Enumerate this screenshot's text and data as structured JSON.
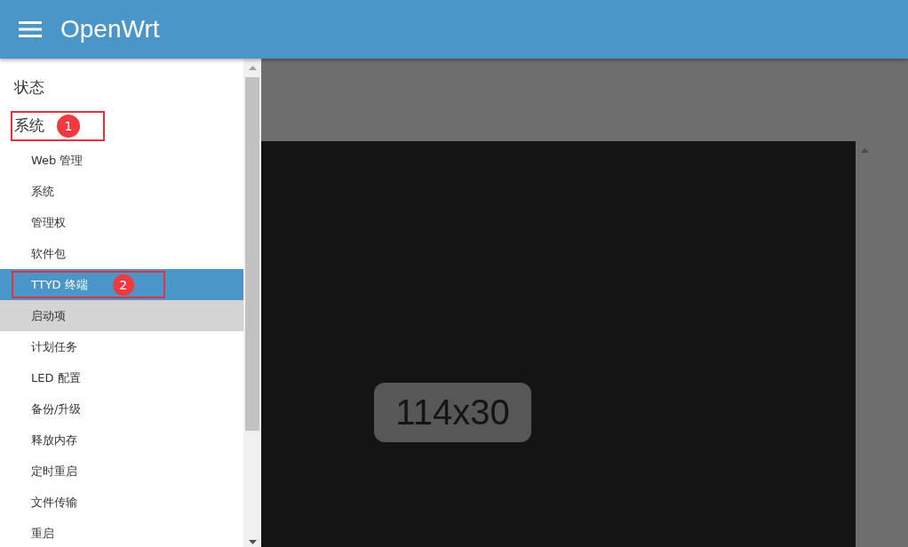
{
  "header": {
    "title": "OpenWrt"
  },
  "menu": [
    {
      "label": "状态"
    },
    {
      "label": "系统",
      "annotation": "1",
      "children": [
        {
          "label": "Web 管理",
          "selected": false,
          "hovered": false
        },
        {
          "label": "系统",
          "selected": false,
          "hovered": false
        },
        {
          "label": "管理权",
          "selected": false,
          "hovered": false
        },
        {
          "label": "软件包",
          "selected": false,
          "hovered": false
        },
        {
          "label": "TTYD 终端",
          "selected": true,
          "hovered": false,
          "annotation": "2"
        },
        {
          "label": "启动项",
          "selected": false,
          "hovered": true
        },
        {
          "label": "计划任务",
          "selected": false,
          "hovered": false
        },
        {
          "label": "LED 配置",
          "selected": false,
          "hovered": false
        },
        {
          "label": "备份/升级",
          "selected": false,
          "hovered": false
        },
        {
          "label": "释放内存",
          "selected": false,
          "hovered": false
        },
        {
          "label": "定时重启",
          "selected": false,
          "hovered": false
        },
        {
          "label": "文件传输",
          "selected": false,
          "hovered": false
        },
        {
          "label": "重启",
          "selected": false,
          "hovered": false
        }
      ]
    }
  ],
  "terminal": {
    "size_overlay": "114x30"
  }
}
